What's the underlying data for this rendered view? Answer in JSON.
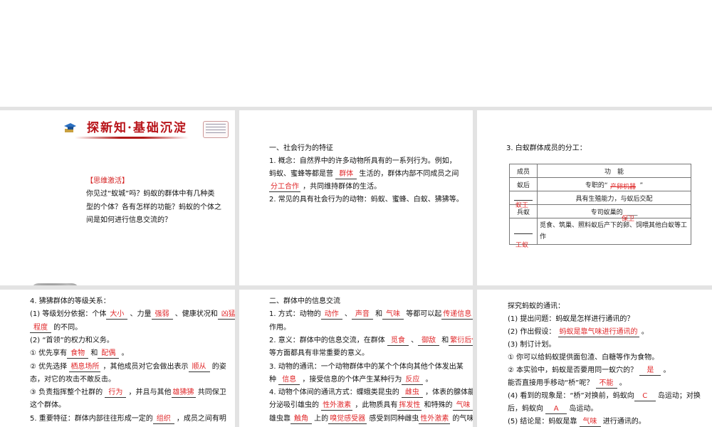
{
  "slide1": {
    "title": "探新知·基础沉淀",
    "label": "【思维激活】",
    "lines": [
      "你见过“蚁城”吗？蚂蚁的群体中有几种类",
      "型的个体？各有怎样的功能？蚂蚁的个体之",
      "间是如何进行信息交流的？"
    ]
  },
  "slide2": {
    "lines": [
      [
        {
          "t": "一、社会行为的特征"
        }
      ],
      [
        {
          "t": "1. 概念：自然界中的许多动物所具有的一系列行为。例如，"
        }
      ],
      [
        {
          "t": "蚂蚁、蜜蜂等都是营 "
        },
        {
          "b": "群体"
        },
        {
          "t": " 生活的，群体内部不同成员之间"
        }
      ],
      [
        {
          "b": "分工合作"
        },
        {
          "t": " ，共同维持群体的生活。"
        }
      ],
      [
        {
          "t": "2. 常见的具有社会行为的动物：蚂蚁、蜜蜂、白蚁、狒狒等。"
        }
      ]
    ]
  },
  "slide3": {
    "title": "3. 白蚁群体成员的分工：",
    "header": [
      "成员",
      "功　能"
    ],
    "rows": [
      {
        "member": "蚁后",
        "member_answer": "",
        "func": "专职的“　　　　　”",
        "func_answer": "产卵机器"
      },
      {
        "member": "",
        "member_answer": "蚁王",
        "func": "具有生殖能力，与蚁后交配",
        "func_answer": ""
      },
      {
        "member": "兵蚁",
        "member_answer": "",
        "func": "专司蚁巢的 ____",
        "func_answer": "保卫"
      },
      {
        "member": "",
        "member_answer": "工蚁",
        "func": "觅食、筑巢、照料蚁后产下的卵、饲喂其他白蚁等工作",
        "func_answer": ""
      }
    ]
  },
  "slide4": {
    "lines": [
      [
        {
          "t": "4. 狒狒群体的等级关系："
        }
      ],
      [
        {
          "t": "(1) 等级划分依据：个体"
        },
        {
          "b": "大小"
        },
        {
          "t": " 、力量"
        },
        {
          "b": "强弱"
        },
        {
          "t": " 、健康状况和"
        },
        {
          "b": "凶猛"
        }
      ],
      [
        {
          "b": "程度"
        },
        {
          "t": " 的不同。"
        }
      ],
      [
        {
          "t": "(2) “首领”的权力和义务。"
        }
      ],
      [
        {
          "t": "① 优先享有"
        },
        {
          "b": "食物"
        },
        {
          "t": " 和"
        },
        {
          "b": "配偶"
        },
        {
          "t": " 。"
        }
      ],
      [
        {
          "t": "② 优先选择 "
        },
        {
          "b": "栖息场所"
        },
        {
          "t": " ，其他成员对它会做出表示"
        },
        {
          "b": "顺从"
        },
        {
          "t": " 的姿"
        }
      ],
      [
        {
          "t": "态，对它的攻击不敢反击。"
        }
      ],
      [
        {
          "t": "③ 负责指挥整个社群的 "
        },
        {
          "b": "行为"
        },
        {
          "t": " ，并且与其他"
        },
        {
          "b": "雄狒狒"
        },
        {
          "t": " 共同保卫"
        }
      ],
      [
        {
          "t": "这个群体。"
        }
      ],
      [
        {
          "t": "5. 重要特征：群体内部往往形成一定的"
        },
        {
          "b": "组织"
        },
        {
          "t": " ，成员之间有明"
        }
      ]
    ]
  },
  "slide5": {
    "lines": [
      [
        {
          "t": "二、群体中的信息交流"
        }
      ],
      [
        {
          "t": "1. 方式：动物的"
        },
        {
          "b": "动作"
        },
        {
          "t": " 、"
        },
        {
          "b": "声音"
        },
        {
          "t": " 和"
        },
        {
          "b": "气味"
        },
        {
          "t": " 等都可以起"
        },
        {
          "b": "传递信息"
        },
        {
          "t": " 的"
        }
      ],
      [
        {
          "t": "作用。"
        }
      ],
      [
        {
          "t": "2. 意义：群体中的信息交流，在群体 "
        },
        {
          "b": "觅食"
        },
        {
          "t": " 、"
        },
        {
          "b": "御敌"
        },
        {
          "t": " 和"
        },
        {
          "b": "繁衍后代"
        }
      ],
      [
        {
          "t": "等方面都具有非常重要的意义。"
        }
      ],
      [
        {
          "t": "3. 动物的通讯：一个动物群体中的某个个体向其他个体发出某"
        }
      ],
      [
        {
          "t": "种 "
        },
        {
          "b": "信息"
        },
        {
          "t": " ，接受信息的个体产生某种行为"
        },
        {
          "b": "反应"
        },
        {
          "t": " 。"
        }
      ],
      [
        {
          "t": "4. 动物个体间的通讯方式：蝶蛾类昆虫的 "
        },
        {
          "b": "雌虫"
        },
        {
          "t": " ，体表的腺体能"
        }
      ],
      [
        {
          "t": "分泌吸引雄虫的 "
        },
        {
          "b": "性外激素"
        },
        {
          "t": " ，此物质具有"
        },
        {
          "b": "挥发性"
        },
        {
          "t": " 和特殊的"
        },
        {
          "b": "气味"
        }
      ],
      [
        {
          "t": "雄虫靠"
        },
        {
          "b": "触角"
        },
        {
          "t": " 上的"
        },
        {
          "b": "嗅觉感受器"
        },
        {
          "t": " 感受到同种雌虫"
        },
        {
          "b": "性外激素"
        },
        {
          "t": " 的气味"
        }
      ]
    ]
  },
  "slide6": {
    "lines": [
      [
        {
          "t": "探究蚂蚁的通讯："
        }
      ],
      [
        {
          "t": "(1) 提出问题：蚂蚁是怎样进行通讯的？"
        }
      ],
      [
        {
          "t": "(2) 作出假设：  "
        },
        {
          "b": "蚂蚁是靠气味进行通讯的"
        },
        {
          "t": " 。"
        }
      ],
      [
        {
          "t": "(3) 制订计划。"
        }
      ],
      [
        {
          "t": "① 你可以给蚂蚁提供面包渣、白糖等作为食物。"
        }
      ],
      [
        {
          "t": "② 本实验中，蚂蚁是否要用同一蚁穴的？ "
        },
        {
          "b": "是"
        },
        {
          "t": " 。"
        }
      ],
      [
        {
          "t": "能否直接用手移动“桥”呢？ "
        },
        {
          "b": "不能"
        },
        {
          "t": " 。"
        }
      ],
      [
        {
          "t": "(4) 看到的现象是：“桥”对换前，蚂蚁向"
        },
        {
          "b": "C"
        },
        {
          "t": " 岛运动；对换"
        }
      ],
      [
        {
          "t": "后，蚂蚁向 "
        },
        {
          "b": "A"
        },
        {
          "t": " 岛运动。"
        }
      ],
      [
        {
          "t": "(5) 结论是：蚂蚁是靠 "
        },
        {
          "b": "气味"
        },
        {
          "t": " 进行通讯的。"
        }
      ]
    ]
  }
}
